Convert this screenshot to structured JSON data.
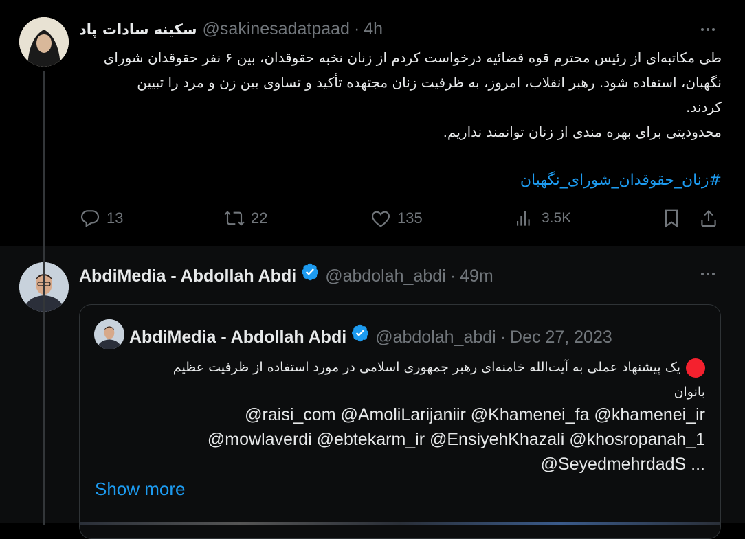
{
  "post1": {
    "display_name": "سکینه سادات پاد",
    "handle": "@sakinesadatpaad",
    "separator": "·",
    "time": "4h",
    "text_lines": [
      "طی مکاتبه‌ای از رئیس محترم قوه قضائیه درخواست کردم از زنان نخبه حقوقدان، بین ۶ نفر حقوقدان شورای",
      "نگهبان، استفاده شود. رهبر انقلاب، امروز، به ظرفیت زنان مجتهده تأکید و تساوی بین زن و مرد را تبیین",
      "کردند.",
      "محدودیتی برای بهره مندی از زنان توانمند نداریم."
    ],
    "hashtag": "#زنان_حقوقدان_شورای_نگهبان",
    "actions": {
      "replies": "13",
      "reposts": "22",
      "likes": "135",
      "views": "3.5K"
    }
  },
  "post2": {
    "display_name": "AbdiMedia - Abdollah Abdi",
    "handle": "@abdolah_abdi",
    "separator": "·",
    "time": "49m",
    "quote": {
      "display_name": "AbdiMedia - Abdollah Abdi",
      "handle": "@abdolah_abdi",
      "separator": "·",
      "date": "Dec 27, 2023",
      "text_line1": "یک پیشنهاد عملی به آیت‌الله خامنه‌ای رهبر جمهوری اسلامی در مورد استفاده از ظرفیت عظیم",
      "text_line2": "بانوان",
      "mentions_line1": "@raisi_com @AmoliLarijaniir @Khamenei_fa @khamenei_ir",
      "mentions_line2": "@mowlaverdi @ebtekarm_ir @EnsiyehKhazali @khosropanah_1",
      "mentions_line3": "@SeyedmehrdadS ...",
      "show_more": "Show more"
    }
  },
  "colors": {
    "background": "#000000",
    "text": "#e7e9ea",
    "muted": "#71767b",
    "link": "#1d9bf0",
    "verified": "#1d9bf0",
    "red_dot": "#f4212e"
  }
}
